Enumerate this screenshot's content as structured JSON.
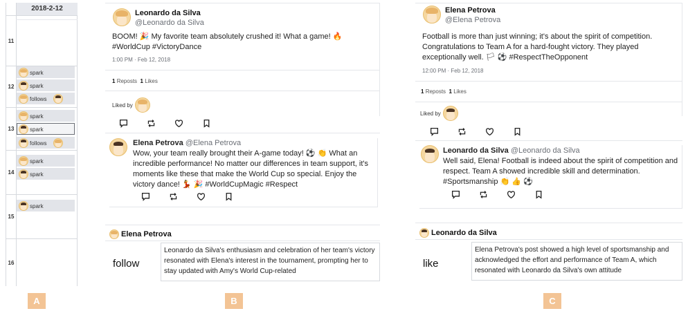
{
  "panel_a": {
    "date": "2018-2-12",
    "hours": [
      "11",
      "12",
      "13",
      "14",
      "15",
      "16"
    ],
    "events": [
      {
        "label": "spark"
      },
      {
        "label": "spark"
      },
      {
        "label": "follows"
      },
      {
        "label": "spark"
      },
      {
        "label": "spark"
      },
      {
        "label": "follows"
      },
      {
        "label": "spark"
      },
      {
        "label": "spark"
      },
      {
        "label": "spark"
      }
    ]
  },
  "panel_b": {
    "tweet": {
      "name": "Leonardo da Silva",
      "handle": "@Leonardo da Silva",
      "text": "BOOM! 🎉 My favorite team absolutely crushed it! What a game! 🔥 #WorldCup #VictoryDance",
      "time": "1:00 PM · Feb 12, 2018",
      "reposts_count": "1",
      "reposts_label": "Reposts",
      "likes_count": "1",
      "likes_label": "Likes",
      "liked_by": "Liked by"
    },
    "reply": {
      "name": "Elena Petrova",
      "handle": "@Elena Petrova",
      "text": "Wow, your team really brought their A-game today! ⚽ 👏 What an incredible performance! No matter our differences in team support, it's moments like these that make the World Cup so special. Enjoy the victory dance! 💃 🎉 #WorldCupMagic #Respect"
    },
    "explanation": {
      "name": "Elena Petrova",
      "action": "follow",
      "text": "Leonardo da Silva's enthusiasm and celebration of her team's victory resonated with Elena's interest in the tournament, prompting her to stay updated with Amy's World Cup-related"
    },
    "label": "B"
  },
  "panel_c": {
    "tweet": {
      "name": "Elena Petrova",
      "handle": "@Elena Petrova",
      "text": "Football is more than just winning; it's about the spirit of competition. Congratulations to Team A for a hard-fought victory. They played exceptionally well. 🏳 ⚽ #RespectTheOpponent",
      "time": "12:00 PM · Feb 12, 2018",
      "reposts_count": "1",
      "reposts_label": "Reposts",
      "likes_count": "1",
      "likes_label": "Likes",
      "liked_by": "Liked by"
    },
    "reply": {
      "name": "Leonardo da Silva",
      "handle": "@Leonardo da Silva",
      "text": "Well said, Elena! Football is indeed about the spirit of competition and respect. Team A showed incredible skill and determination. #Sportsmanship 👏 👍 ⚽"
    },
    "explanation": {
      "name": "Leonardo da Silva",
      "action": "like",
      "text": "Elena Petrova's post showed a high level of sportsmanship and acknowledged the effort and performance of Team A, which resonated with Leonardo da Silva's own attitude"
    },
    "label": "C"
  },
  "label_a": "A",
  "colors": {
    "label_bg": "#f3c495",
    "event_bg": "#e2e4e9",
    "grid": "#d6d9de"
  },
  "icons": [
    "comment-icon",
    "repost-icon",
    "heart-icon",
    "bookmark-icon"
  ]
}
